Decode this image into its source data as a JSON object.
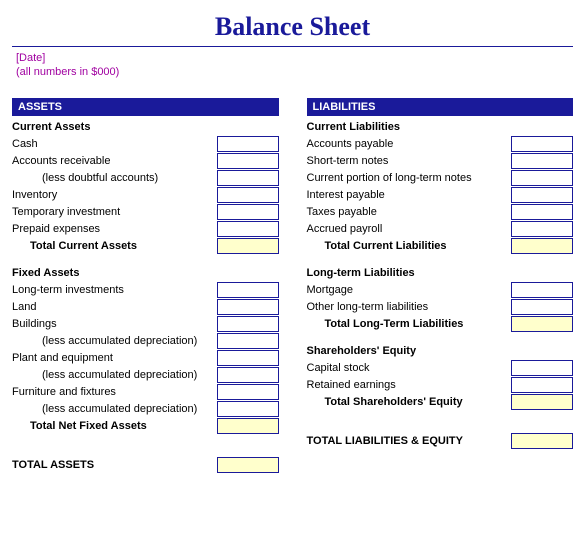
{
  "title": "Balance Sheet",
  "meta": {
    "date": "[Date]",
    "units": "(all numbers in $000)"
  },
  "left": {
    "header": "ASSETS",
    "sections": [
      {
        "title": "Current Assets",
        "items": [
          {
            "label": "Cash"
          },
          {
            "label": "Accounts receivable"
          },
          {
            "label": "(less doubtful accounts)",
            "indent": true
          },
          {
            "label": "Inventory"
          },
          {
            "label": "Temporary investment"
          },
          {
            "label": "Prepaid expenses"
          }
        ],
        "total": "Total Current Assets"
      },
      {
        "title": "Fixed Assets",
        "items": [
          {
            "label": "Long-term investments"
          },
          {
            "label": "Land"
          },
          {
            "label": "Buildings"
          },
          {
            "label": "(less accumulated depreciation)",
            "indent": true
          },
          {
            "label": "Plant and equipment"
          },
          {
            "label": "(less accumulated depreciation)",
            "indent": true
          },
          {
            "label": "Furniture and fixtures"
          },
          {
            "label": "(less accumulated depreciation)",
            "indent": true
          }
        ],
        "total": "Total Net Fixed Assets"
      }
    ],
    "grand": "TOTAL ASSETS"
  },
  "right": {
    "header": "LIABILITIES",
    "sections": [
      {
        "title": "Current Liabilities",
        "items": [
          {
            "label": "Accounts payable"
          },
          {
            "label": "Short-term notes"
          },
          {
            "label": "Current portion of long-term notes"
          },
          {
            "label": "Interest payable"
          },
          {
            "label": "Taxes payable"
          },
          {
            "label": "Accrued payroll"
          }
        ],
        "total": "Total Current Liabilities"
      },
      {
        "title": "Long-term Liabilities",
        "items": [
          {
            "label": "Mortgage"
          },
          {
            "label": "Other long-term liabilities"
          }
        ],
        "total": "Total Long-Term Liabilities"
      },
      {
        "title": "Shareholders' Equity",
        "items": [
          {
            "label": "Capital stock"
          },
          {
            "label": "Retained earnings"
          }
        ],
        "total": "Total Shareholders' Equity"
      }
    ],
    "grand": "TOTAL LIABILITIES & EQUITY"
  }
}
